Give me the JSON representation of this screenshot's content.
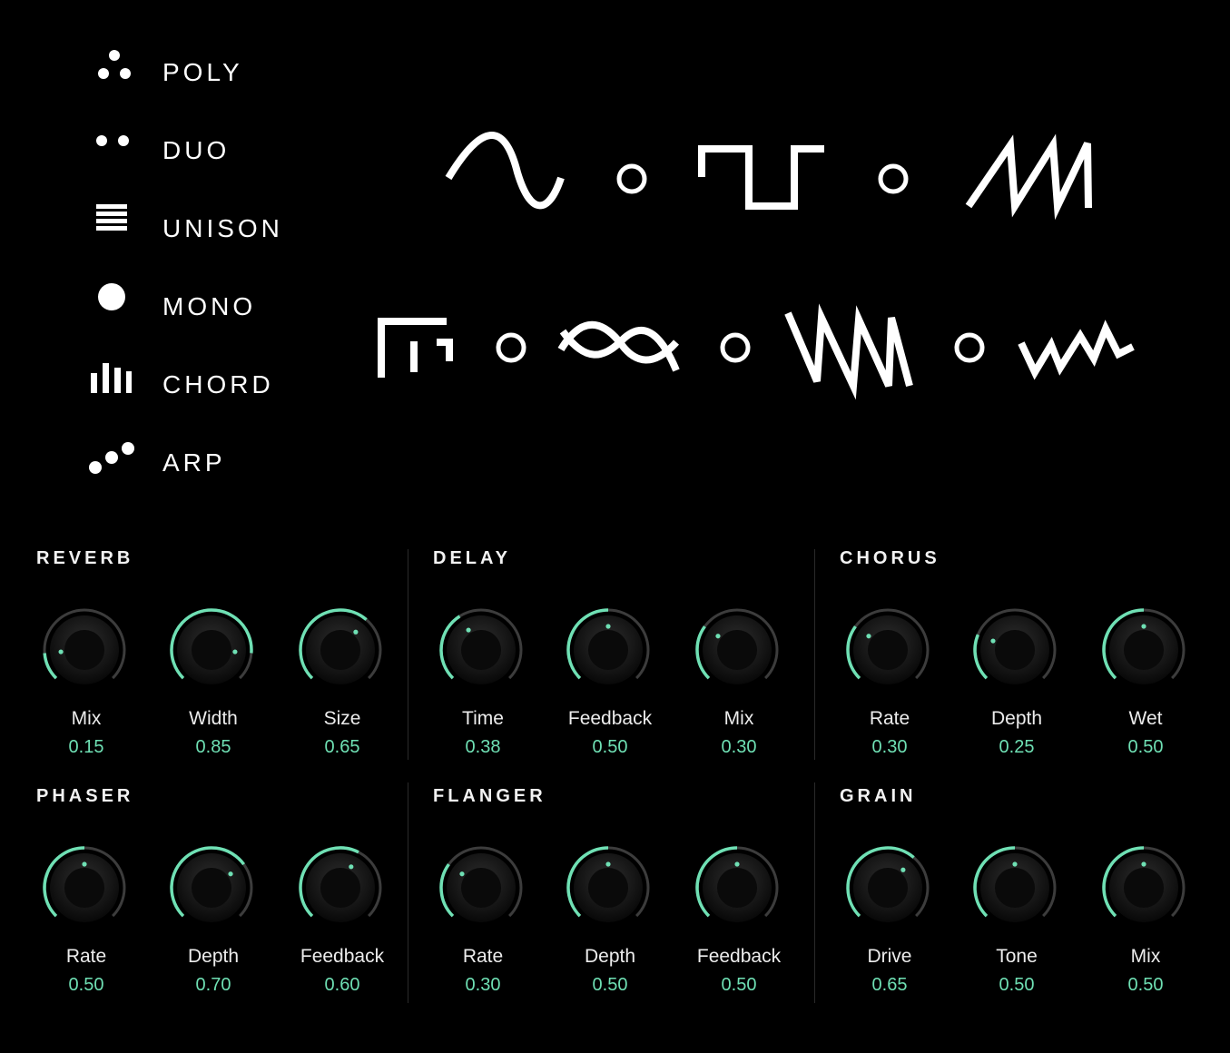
{
  "colors": {
    "background": "#000000",
    "accent": "#6fe0b4",
    "track": "#3c3c3c",
    "text": "#ffffff"
  },
  "voice_modes": [
    {
      "label": "POLY",
      "icon": "three-dots-icon"
    },
    {
      "label": "DUO",
      "icon": "two-dots-icon"
    },
    {
      "label": "UNISON",
      "icon": "stacked-lines-icon"
    },
    {
      "label": "MONO",
      "icon": "single-dot-icon"
    },
    {
      "label": "CHORD",
      "icon": "bars-icon"
    },
    {
      "label": "ARP",
      "icon": "ascending-dots-icon"
    }
  ],
  "waveforms": [
    "sine-wave-icon",
    "square-wave-icon",
    "saw-wave-icon",
    "stepped-wave-icon",
    "crossed-wave-icon",
    "reverse-saw-wave-icon",
    "noise-wave-icon"
  ],
  "effects": [
    {
      "title": "REVERB",
      "knobs": [
        {
          "name": "Mix",
          "value": "0.15",
          "level": 0.15
        },
        {
          "name": "Width",
          "value": "0.85",
          "level": 0.85
        },
        {
          "name": "Size",
          "value": "0.65",
          "level": 0.65
        }
      ]
    },
    {
      "title": "DELAY",
      "knobs": [
        {
          "name": "Time",
          "value": "0.38",
          "level": 0.38
        },
        {
          "name": "Feedback",
          "value": "0.50",
          "level": 0.5
        },
        {
          "name": "Mix",
          "value": "0.30",
          "level": 0.3
        }
      ]
    },
    {
      "title": "CHORUS",
      "knobs": [
        {
          "name": "Rate",
          "value": "0.30",
          "level": 0.3
        },
        {
          "name": "Depth",
          "value": "0.25",
          "level": 0.25
        },
        {
          "name": "Wet",
          "value": "0.50",
          "level": 0.5
        }
      ]
    },
    {
      "title": "PHASER",
      "knobs": [
        {
          "name": "Rate",
          "value": "0.50",
          "level": 0.5
        },
        {
          "name": "Depth",
          "value": "0.70",
          "level": 0.7
        },
        {
          "name": "Feedback",
          "value": "0.60",
          "level": 0.6
        }
      ]
    },
    {
      "title": "FLANGER",
      "knobs": [
        {
          "name": "Rate",
          "value": "0.30",
          "level": 0.3
        },
        {
          "name": "Depth",
          "value": "0.50",
          "level": 0.5
        },
        {
          "name": "Feedback",
          "value": "0.50",
          "level": 0.5
        }
      ]
    },
    {
      "title": "GRAIN",
      "knobs": [
        {
          "name": "Drive",
          "value": "0.65",
          "level": 0.65
        },
        {
          "name": "Tone",
          "value": "0.50",
          "level": 0.5
        },
        {
          "name": "Mix",
          "value": "0.50",
          "level": 0.5
        }
      ]
    }
  ]
}
